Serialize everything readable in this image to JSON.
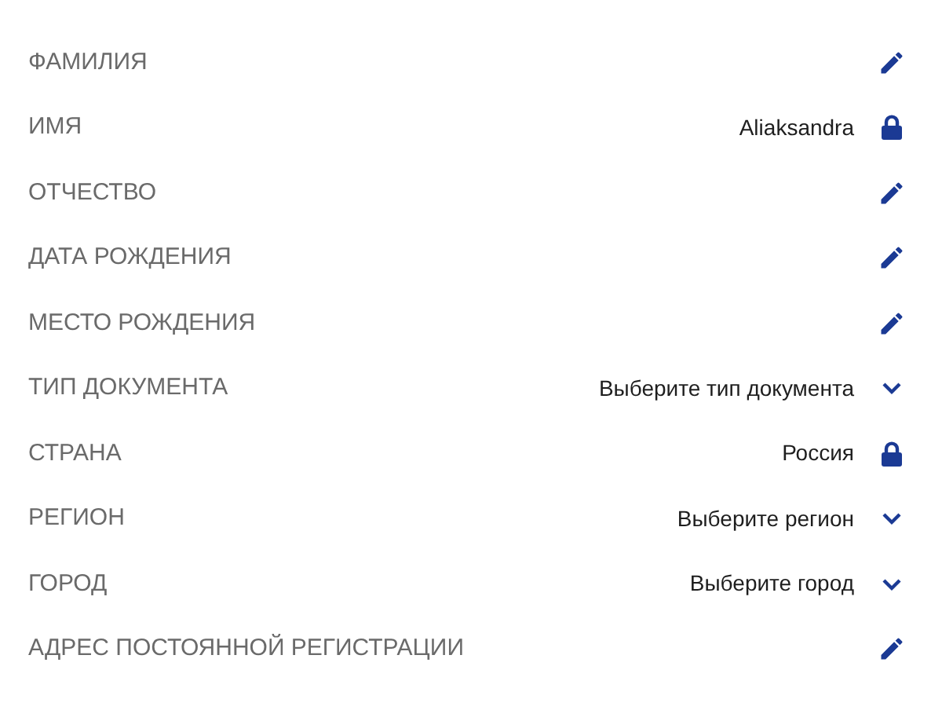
{
  "fields": [
    {
      "label": "ФАМИЛИЯ",
      "kind": "edit"
    },
    {
      "label": "ИМЯ",
      "value": "Aliaksandra",
      "kind": "locked"
    },
    {
      "label": "ОТЧЕСТВО",
      "kind": "edit"
    },
    {
      "label": "ДАТА РОЖДЕНИЯ",
      "kind": "edit"
    },
    {
      "label": "МЕСТО РОЖДЕНИЯ",
      "kind": "edit"
    },
    {
      "label": "ТИП ДОКУМЕНТА",
      "placeholder": "Выберите тип документа",
      "kind": "select"
    },
    {
      "label": "СТРАНА",
      "value": "Россия",
      "kind": "locked"
    },
    {
      "label": "РЕГИОН",
      "placeholder": "Выберите регион",
      "kind": "select"
    },
    {
      "label": "ГОРОД",
      "placeholder": "Выберите город",
      "kind": "select"
    },
    {
      "label": "АДРЕС ПОСТОЯННОЙ РЕГИСТРАЦИИ",
      "kind": "edit"
    }
  ]
}
